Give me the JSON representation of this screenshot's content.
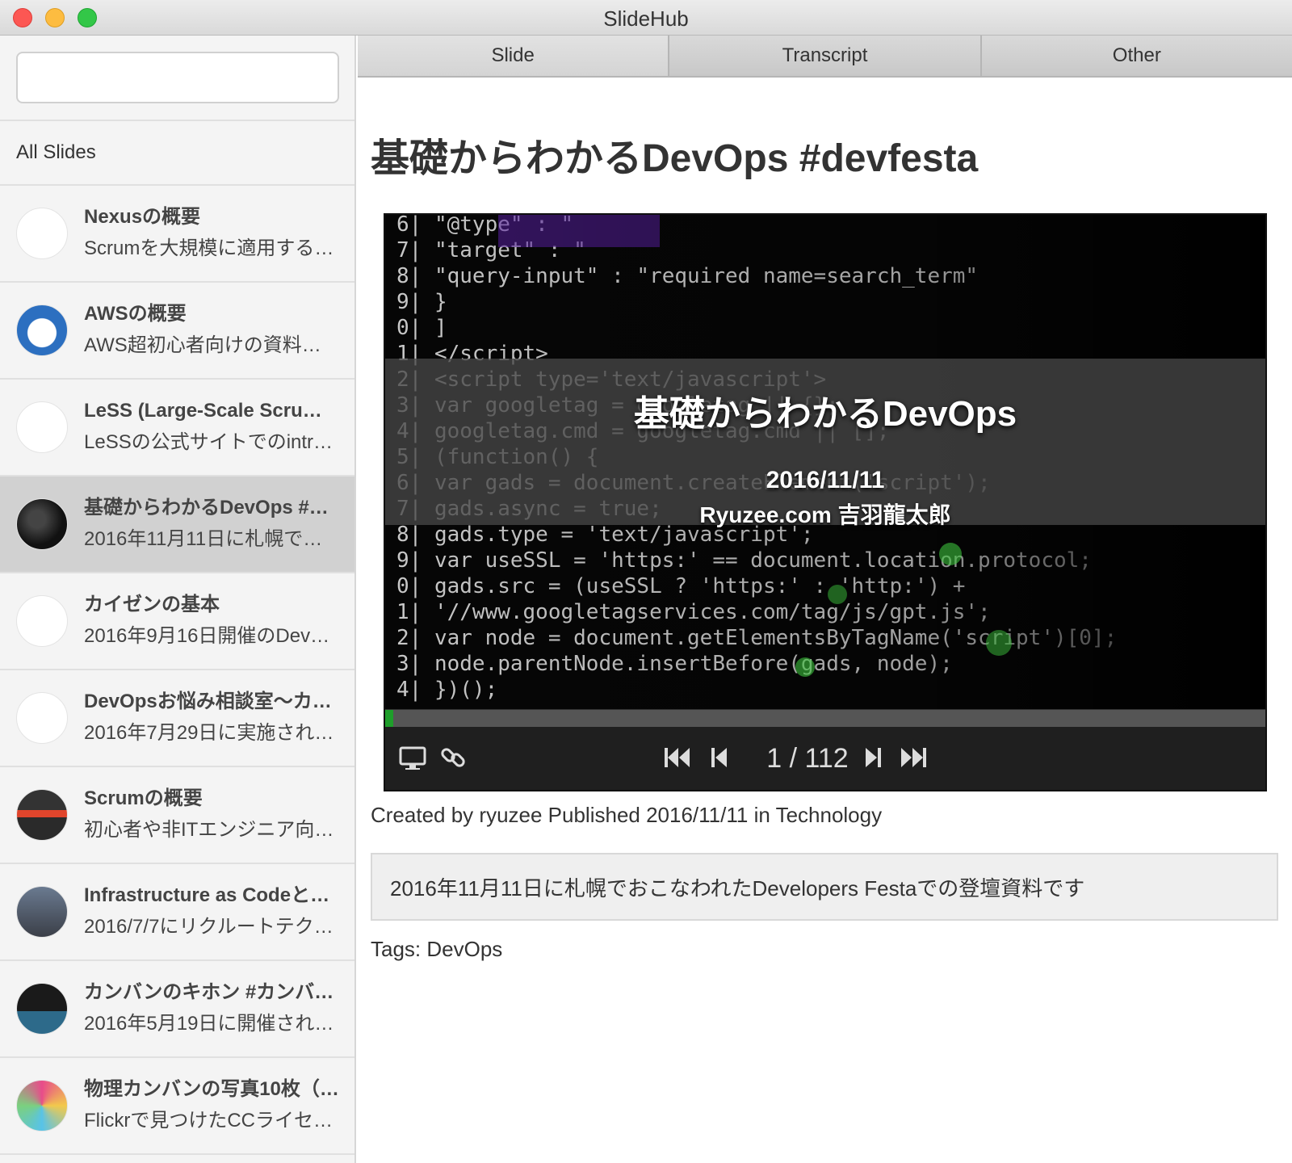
{
  "window": {
    "title": "SlideHub"
  },
  "search": {
    "value": "",
    "placeholder": ""
  },
  "sidebar": {
    "all_slides_label": "All Slides",
    "items": [
      {
        "title": "Nexusの概要",
        "desc": "Scrumを大規模に適用する…",
        "thumb": "light"
      },
      {
        "title": "AWSの概要",
        "desc": "AWS超初心者向けの資料…",
        "thumb": "blue-cloud"
      },
      {
        "title": "LeSS (Large-Scale Scru…",
        "desc": "LeSSの公式サイトでのintr…",
        "thumb": "light"
      },
      {
        "title": "基礎からわかるDevOps #…",
        "desc": "2016年11月11日に札幌で…",
        "thumb": "dark-code"
      },
      {
        "title": "カイゼンの基本",
        "desc": "2016年9月16日開催のDev…",
        "thumb": "light"
      },
      {
        "title": "DevOpsお悩み相談室〜カ…",
        "desc": "2016年7月29日に実施され…",
        "thumb": "light"
      },
      {
        "title": "Scrumの概要",
        "desc": "初心者や非ITエンジニア向…",
        "thumb": "dark-red"
      },
      {
        "title": "Infrastructure as Codeと…",
        "desc": "2016/7/7にリクルートテク…",
        "thumb": "dark-photo"
      },
      {
        "title": "カンバンのキホン #カンバ…",
        "desc": "2016年5月19日に開催され…",
        "thumb": "dark-board"
      },
      {
        "title": "物理カンバンの写真10枚（…",
        "desc": "Flickrで見つけたCCライセ…",
        "thumb": "colorful"
      }
    ],
    "selected_index": 3
  },
  "tabs": [
    {
      "label": "Slide"
    },
    {
      "label": "Transcript"
    },
    {
      "label": "Other"
    }
  ],
  "detail": {
    "title": "基礎からわかるDevOps #devfesta",
    "slide": {
      "title": "基礎からわかるDevOps",
      "date": "2016/11/11",
      "author": "Ryuzee.com 吉羽龍太郎"
    },
    "player": {
      "page_text": "1 / 112",
      "current_page": 1,
      "total_pages": 112,
      "progress": 0.009
    },
    "meta": "Created by ryuzee Published 2016/11/11 in Technology",
    "description": "2016年11月11日に札幌でおこなわれたDevelopers Festaでの登壇資料です",
    "tags": "Tags: DevOps"
  },
  "colors": {
    "progress": "#1e9e2a",
    "selected_row": "#d1d1d1"
  },
  "icons": [
    "monitor-icon",
    "link-icon",
    "first-page-icon",
    "previous-page-icon",
    "next-page-icon",
    "last-page-icon"
  ]
}
